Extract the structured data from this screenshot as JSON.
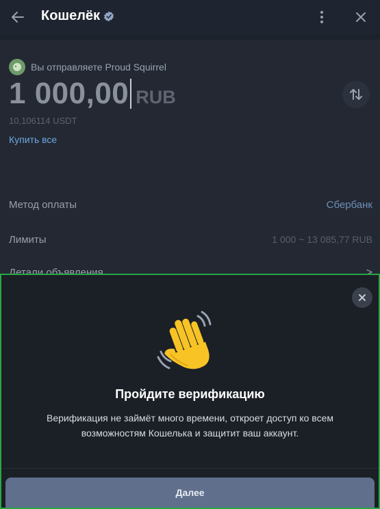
{
  "header": {
    "title": "Кошелёк",
    "back_icon": "arrow-left-icon",
    "verified_icon": "verified-badge-icon",
    "more_icon": "more-vertical-icon",
    "close_icon": "close-icon"
  },
  "send": {
    "recipient_text": "Вы отправляете Proud Squirrel",
    "amount": "1 000,00",
    "currency": "RUB",
    "converted": "10,106114 USDT",
    "buy_all": "Купить все"
  },
  "details": [
    {
      "label": "Метод оплаты",
      "value": "Сбербанк"
    },
    {
      "label": "Лимиты",
      "value": "1 000 ~ 13 085,77 RUB"
    },
    {
      "label": "Детали объявления",
      "value": ">"
    }
  ],
  "modal": {
    "title": "Пройдите верификацию",
    "text": "Верификация не займёт много времени, откроет доступ ко всем возможностям Кошелька и защитит ваш аккаунт.",
    "button": "Далее",
    "icon": "waving-hand-icon"
  },
  "colors": {
    "accent": "#6ea8e0",
    "overlay_border": "#27a844",
    "button": "#5f6f8c"
  }
}
